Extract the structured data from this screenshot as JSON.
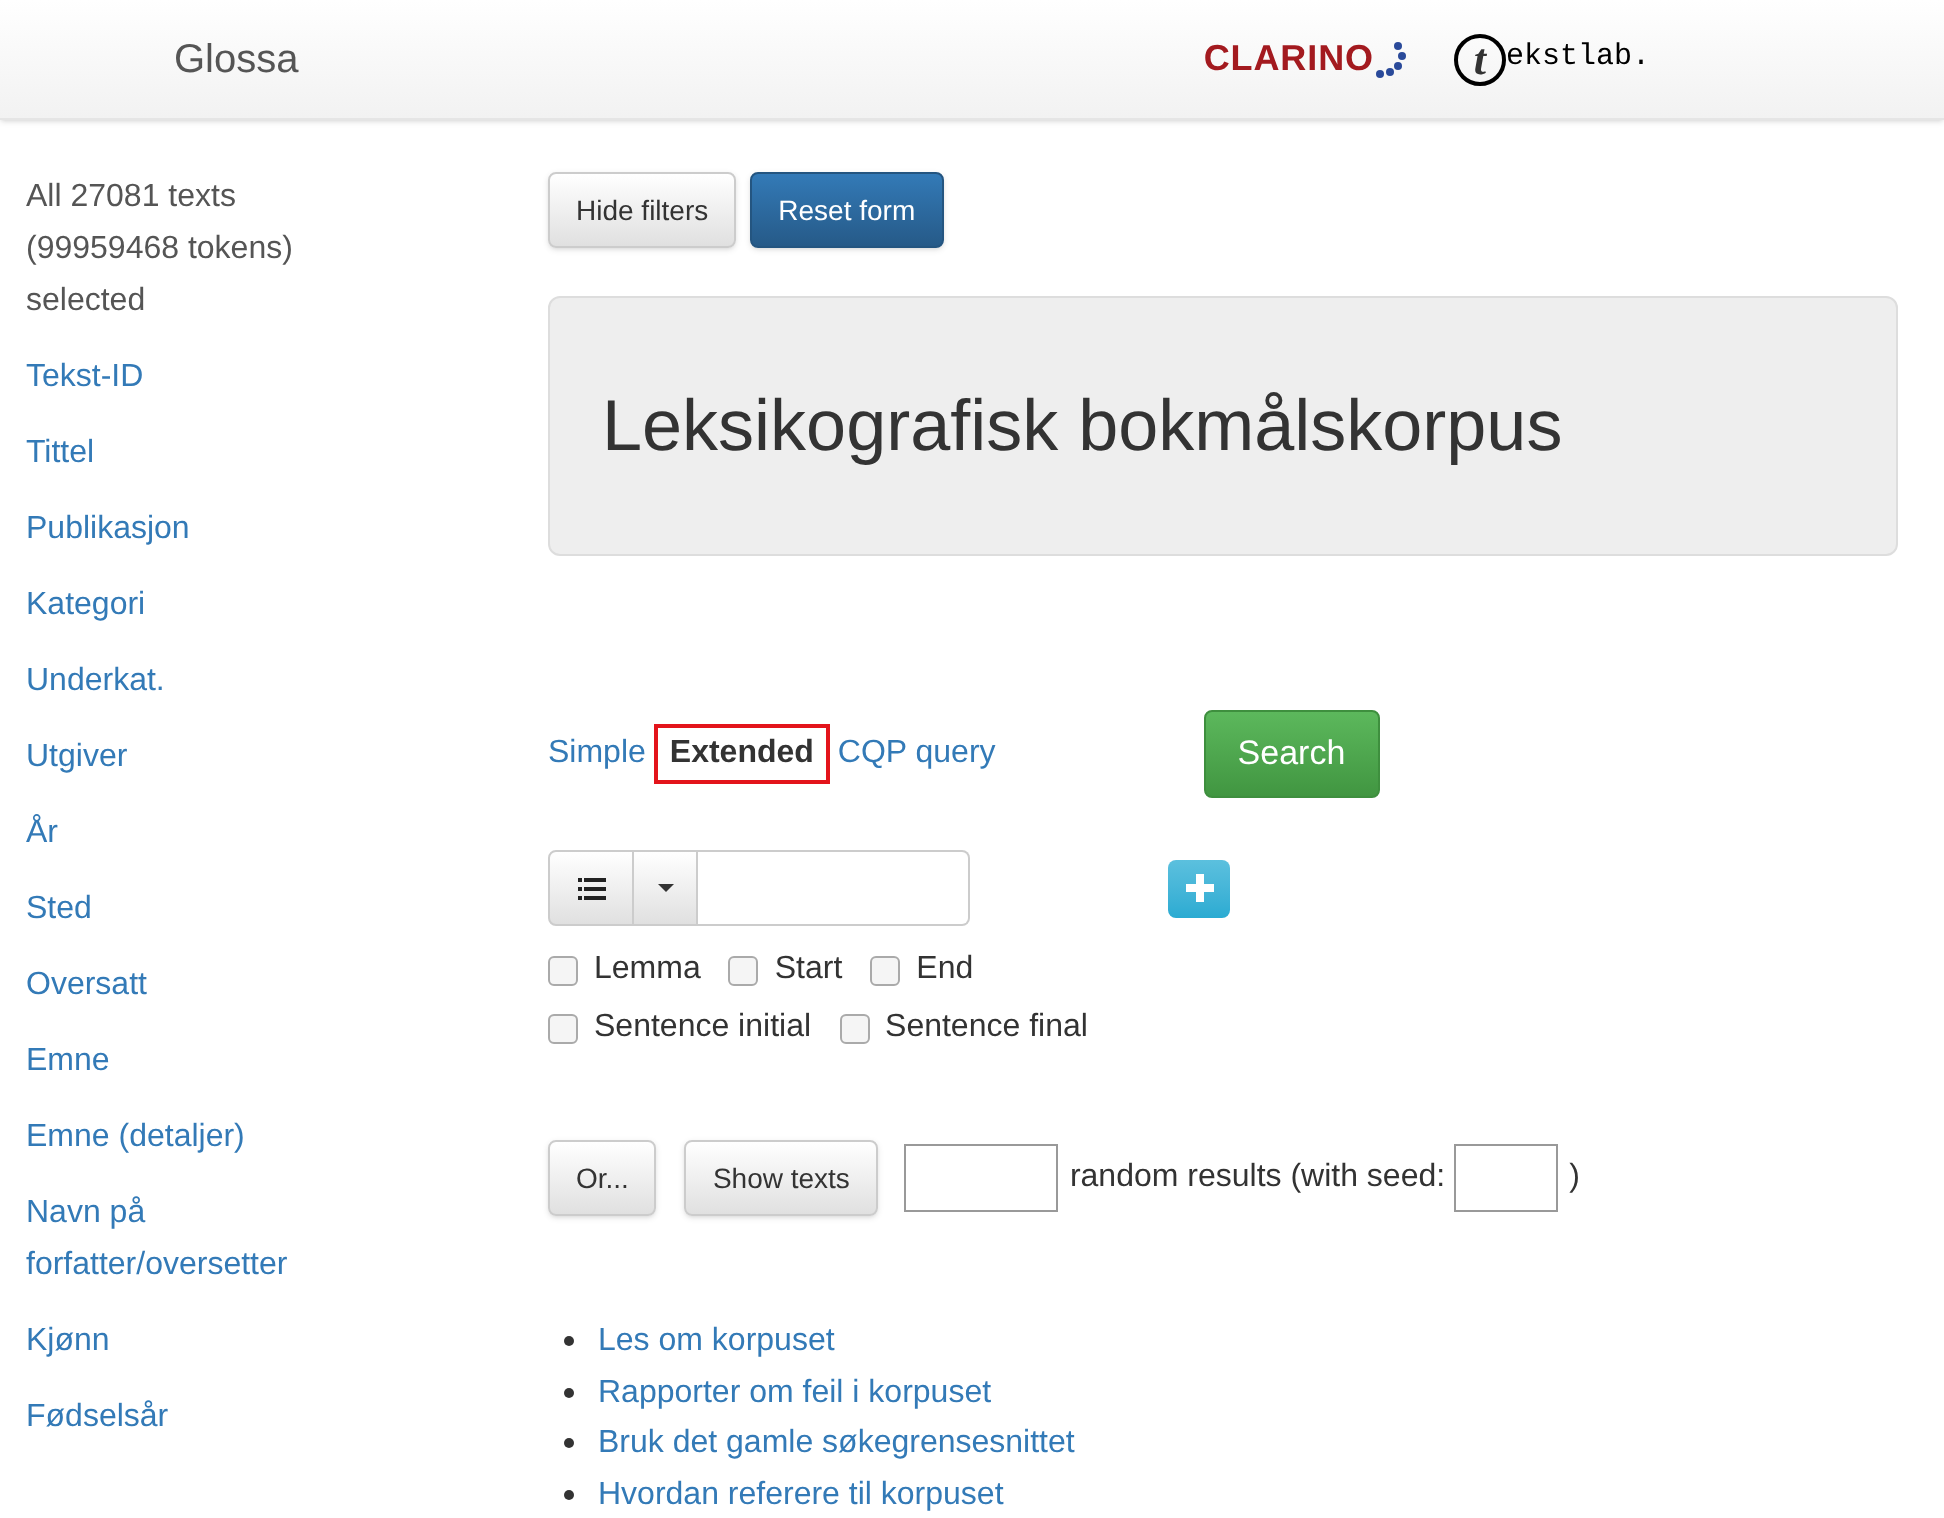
{
  "header": {
    "brand": "Glossa",
    "logos": {
      "clarino": "CLARINO",
      "tekstlab_initial": "t",
      "tekstlab_rest": "ekstlab."
    }
  },
  "sidebar": {
    "summary": "All 27081 texts (99959468 tokens) selected",
    "items": [
      "Tekst-ID",
      "Tittel",
      "Publikasjon",
      "Kategori",
      "Underkat.",
      "Utgiver",
      "År",
      "Sted",
      "Oversatt",
      "Emne",
      "Emne (detaljer)",
      "Navn på forfatter/oversetter",
      "Kjønn",
      "Fødselsår"
    ]
  },
  "toolbar": {
    "hide_filters": "Hide filters",
    "reset_form": "Reset form"
  },
  "corpus_title": "Leksikografisk bokmålskorpus",
  "query_tabs": [
    {
      "label": "Simple",
      "selected": false
    },
    {
      "label": "Extended",
      "selected": true
    },
    {
      "label": "CQP query",
      "selected": false
    }
  ],
  "search_button": "Search",
  "term_options": [
    {
      "label": "Lemma",
      "checked": false
    },
    {
      "label": "Start",
      "checked": false
    },
    {
      "label": "End",
      "checked": false
    },
    {
      "label": "Sentence initial",
      "checked": false
    },
    {
      "label": "Sentence final",
      "checked": false
    }
  ],
  "actions": {
    "or": "Or...",
    "show_texts": "Show texts",
    "random_label": "random results (with seed:",
    "close_paren": ")"
  },
  "links": [
    "Les om korpuset",
    "Rapporter om feil i korpuset",
    "Bruk det gamle søkegrensesnittet",
    "Hvordan referere til korpuset"
  ]
}
